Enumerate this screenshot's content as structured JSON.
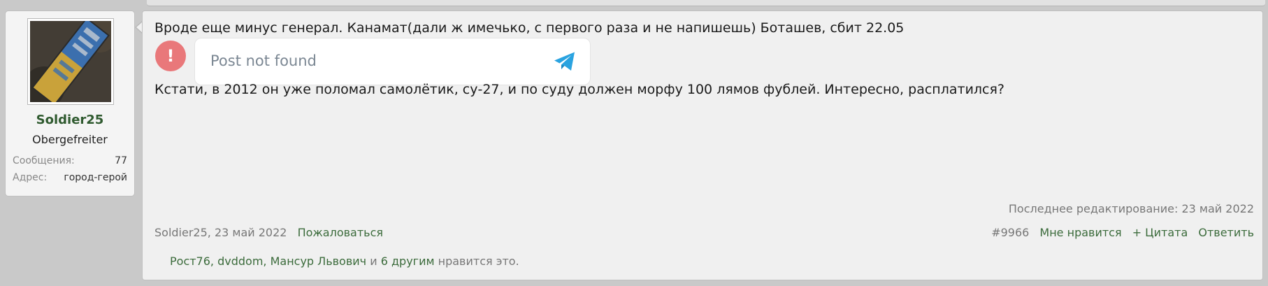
{
  "user": {
    "name": "Soldier25",
    "title": "Obergefreiter",
    "stats": [
      {
        "label": "Сообщения:",
        "value": "77"
      },
      {
        "label": "Адрес:",
        "value": "город-герой"
      }
    ]
  },
  "post": {
    "line1": "Вроде еще минус генерал. Канамат(дали ж имечько, с первого раза и не напишешь) Боташев, сбит 22.05",
    "embed": {
      "alert_icon": "!",
      "message": "Post not found",
      "icon": "telegram-icon"
    },
    "line2": "Кстати, в 2012 он уже поломал самолётик, су-27, и по суду должен морфу 100 лямов фублей. Интересно, расплатился?",
    "last_edit": "Последнее редактирование: 23 май 2022",
    "author_date": "Soldier25, 23 май 2022",
    "report": "Пожаловаться",
    "post_number": "#9966",
    "like": "Мне нравится",
    "quote": "+ Цитата",
    "reply": "Ответить",
    "likes_bar": {
      "names": [
        "Рост76",
        "dvddom",
        "Мансур Львович"
      ],
      "sep1": ", ",
      "sep2": ", ",
      "and": " и ",
      "others": "6 другим",
      "suffix": " нравится это."
    }
  },
  "colors": {
    "username": "#2f5a2f",
    "link": "#3b6b3b",
    "alert": "#e9787a",
    "telegram": "#2aa3e0"
  }
}
